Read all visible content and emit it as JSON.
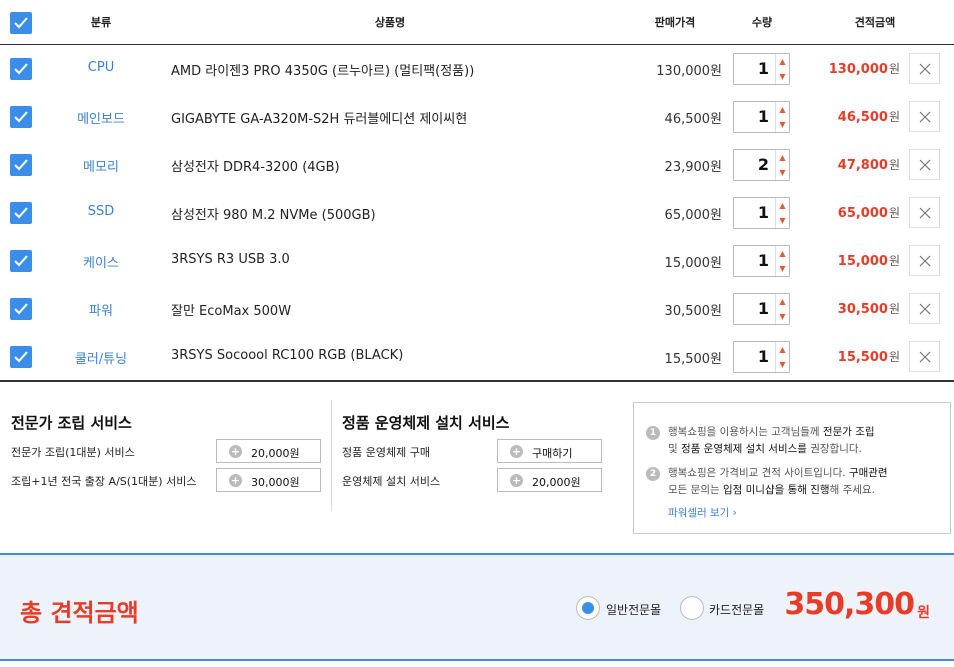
{
  "header": {
    "category": "분류",
    "product": "상품명",
    "price": "판매가격",
    "quantity": "수량",
    "total": "견적금액"
  },
  "rows": [
    {
      "category": "CPU",
      "name": "AMD 라이젠3 PRO 4350G (르누아르) (멀티팩(정품))",
      "price": "130,000원",
      "qty": "1",
      "total": "130,000",
      "unit": "원"
    },
    {
      "category": "메인보드",
      "name": "GIGABYTE GA-A320M-S2H 듀러블에디션 제이씨현",
      "price": "46,500원",
      "qty": "1",
      "total": "46,500",
      "unit": "원"
    },
    {
      "category": "메모리",
      "name": "삼성전자 DDR4-3200 (4GB)",
      "price": "23,900원",
      "qty": "2",
      "total": "47,800",
      "unit": "원"
    },
    {
      "category": "SSD",
      "name": "삼성전자 980 M.2 NVMe (500GB)",
      "price": "65,000원",
      "qty": "1",
      "total": "65,000",
      "unit": "원"
    },
    {
      "category": "케이스",
      "name": "3RSYS R3 USB 3.0",
      "price": "15,000원",
      "qty": "1",
      "total": "15,000",
      "unit": "원"
    },
    {
      "category": "파워",
      "name": "잘만 EcoMax 500W",
      "price": "30,500원",
      "qty": "1",
      "total": "30,500",
      "unit": "원"
    },
    {
      "category": "쿨러/튜닝",
      "name": "3RSYS Socoool RC100 RGB (BLACK)",
      "price": "15,500원",
      "qty": "1",
      "total": "15,500",
      "unit": "원"
    }
  ],
  "services": {
    "assembly": {
      "title": "전문가 조립 서비스",
      "items": [
        {
          "label": "전문가 조립(1대분) 서비스",
          "button": "20,000원"
        },
        {
          "label": "조립+1년 전국 출장 A/S(1대분) 서비스",
          "button": "30,000원"
        }
      ]
    },
    "os": {
      "title": "정품 운영체제 설치 서비스",
      "items": [
        {
          "label": "정품 운영체제 구매",
          "button": "구매하기"
        },
        {
          "label": "운영체제 설치 서비스",
          "button": "20,000원"
        }
      ]
    }
  },
  "notice": {
    "n1": "1",
    "line1a": "행복쇼핑을 이용하시는 고객님들께 ",
    "line1b": "전문가 조립",
    "line2a": "및 ",
    "line2b": "정품 운영체제 설치 서비스를",
    "line2c": " 권장합니다.",
    "n2": "2",
    "line3a": "행복쇼핑은 가격비교 견적 사이트입니다. ",
    "line3b": "구매관련",
    "line4a": "모든 문의는 ",
    "line4b": "입점 미니샵을 통해 진행",
    "line4c": "해 주세요.",
    "link": "파워셀러 보기 ›"
  },
  "footer": {
    "title": "총 견적금액",
    "radio1": "일반전문몰",
    "radio2": "카드전문몰",
    "amount": "350,300",
    "unit": "원"
  },
  "colors": {
    "accent": "#3b8ee8",
    "total_red": "#e63c28",
    "category_blue": "#3b7fd6"
  }
}
